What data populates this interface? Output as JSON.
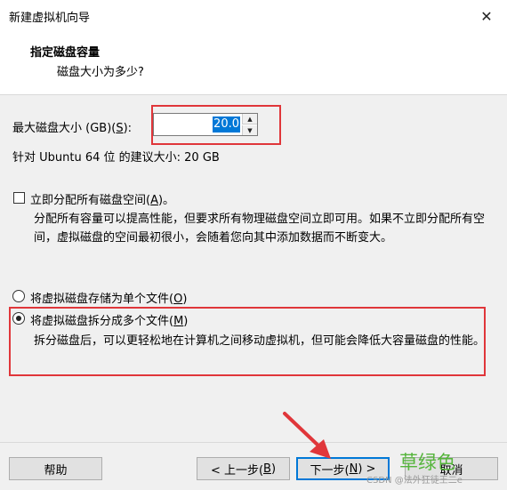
{
  "window": {
    "title": "新建虚拟机向导",
    "close_glyph": "✕"
  },
  "header": {
    "title": "指定磁盘容量",
    "subtitle": "磁盘大小为多少?"
  },
  "disk_size": {
    "label_prefix": "最大磁盘大小 (GB)(",
    "label_key": "S",
    "label_suffix": "):",
    "value": "20.0",
    "recommend": "针对 Ubuntu 64 位 的建议大小: 20 GB"
  },
  "allocate": {
    "label_prefix": "立即分配所有磁盘空间(",
    "label_key": "A",
    "label_suffix": ")。",
    "checked": false,
    "desc": "分配所有容量可以提高性能，但要求所有物理磁盘空间立即可用。如果不立即分配所有空间，虚拟磁盘的空间最初很小，会随着您向其中添加数据而不断变大。"
  },
  "single_file": {
    "label_prefix": "将虚拟磁盘存储为单个文件(",
    "label_key": "O",
    "label_suffix": ")",
    "selected": false
  },
  "multi_file": {
    "label_prefix": "将虚拟磁盘拆分成多个文件(",
    "label_key": "M",
    "label_suffix": ")",
    "selected": true,
    "desc": "拆分磁盘后，可以更轻松地在计算机之间移动虚拟机，但可能会降低大容量磁盘的性能。"
  },
  "buttons": {
    "help": "帮助",
    "back_prefix": "< 上一步(",
    "back_key": "B",
    "back_suffix": ")",
    "next_prefix": "下一步(",
    "next_key": "N",
    "next_suffix": ") >",
    "cancel": "取消"
  },
  "watermark": {
    "big": "草绿色",
    "small": "CSDN @法外狂徒王二e"
  },
  "colors": {
    "highlight": "#e0363a",
    "arrow": "#e0363a",
    "selection": "#0078d7",
    "watermark": "#55b53b"
  }
}
